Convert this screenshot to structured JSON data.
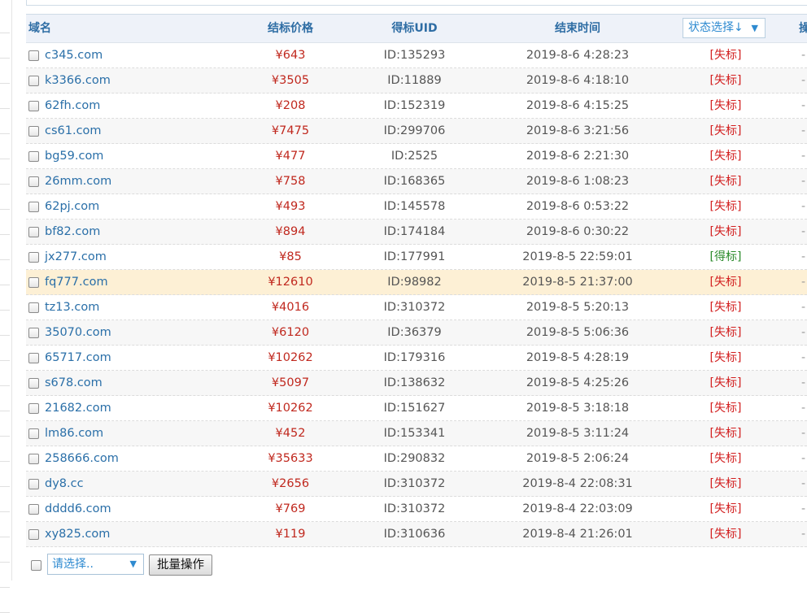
{
  "header": {
    "domain": "域名",
    "price": "结标价格",
    "uid": "得标UID",
    "end_time": "结束时间",
    "status_select": "状态选择↓",
    "status_arrow": "▼",
    "ops": "操"
  },
  "rows": [
    {
      "domain": "c345.com",
      "price": "¥643",
      "uid": "ID:135293",
      "time": "2019-8-6 4:28:23",
      "status": "[失标]",
      "ops": "-"
    },
    {
      "domain": "k3366.com",
      "price": "¥3505",
      "uid": "ID:11889",
      "time": "2019-8-6 4:18:10",
      "status": "[失标]",
      "ops": "-"
    },
    {
      "domain": "62fh.com",
      "price": "¥208",
      "uid": "ID:152319",
      "time": "2019-8-6 4:15:25",
      "status": "[失标]",
      "ops": "-"
    },
    {
      "domain": "cs61.com",
      "price": "¥7475",
      "uid": "ID:299706",
      "time": "2019-8-6 3:21:56",
      "status": "[失标]",
      "ops": "-"
    },
    {
      "domain": "bg59.com",
      "price": "¥477",
      "uid": "ID:2525",
      "time": "2019-8-6 2:21:30",
      "status": "[失标]",
      "ops": "-"
    },
    {
      "domain": "26mm.com",
      "price": "¥758",
      "uid": "ID:168365",
      "time": "2019-8-6 1:08:23",
      "status": "[失标]",
      "ops": "-"
    },
    {
      "domain": "62pj.com",
      "price": "¥493",
      "uid": "ID:145578",
      "time": "2019-8-6 0:53:22",
      "status": "[失标]",
      "ops": "-"
    },
    {
      "domain": "bf82.com",
      "price": "¥894",
      "uid": "ID:174184",
      "time": "2019-8-6 0:30:22",
      "status": "[失标]",
      "ops": "-"
    },
    {
      "domain": "jx277.com",
      "price": "¥85",
      "uid": "ID:177991",
      "time": "2019-8-5 22:59:01",
      "status": "[得标]",
      "ops": "-"
    },
    {
      "domain": "fq777.com",
      "price": "¥12610",
      "uid": "ID:98982",
      "time": "2019-8-5 21:37:00",
      "status": "[失标]",
      "ops": "-"
    },
    {
      "domain": "tz13.com",
      "price": "¥4016",
      "uid": "ID:310372",
      "time": "2019-8-5 5:20:13",
      "status": "[失标]",
      "ops": "-"
    },
    {
      "domain": "35070.com",
      "price": "¥6120",
      "uid": "ID:36379",
      "time": "2019-8-5 5:06:36",
      "status": "[失标]",
      "ops": "-"
    },
    {
      "domain": "65717.com",
      "price": "¥10262",
      "uid": "ID:179316",
      "time": "2019-8-5 4:28:19",
      "status": "[失标]",
      "ops": "-"
    },
    {
      "domain": "s678.com",
      "price": "¥5097",
      "uid": "ID:138632",
      "time": "2019-8-5 4:25:26",
      "status": "[失标]",
      "ops": "-"
    },
    {
      "domain": "21682.com",
      "price": "¥10262",
      "uid": "ID:151627",
      "time": "2019-8-5 3:18:18",
      "status": "[失标]",
      "ops": "-"
    },
    {
      "domain": "lm86.com",
      "price": "¥452",
      "uid": "ID:153341",
      "time": "2019-8-5 3:11:24",
      "status": "[失标]",
      "ops": "-"
    },
    {
      "domain": "258666.com",
      "price": "¥35633",
      "uid": "ID:290832",
      "time": "2019-8-5 2:06:24",
      "status": "[失标]",
      "ops": "-"
    },
    {
      "domain": "dy8.cc",
      "price": "¥2656",
      "uid": "ID:310372",
      "time": "2019-8-4 22:08:31",
      "status": "[失标]",
      "ops": "-"
    },
    {
      "domain": "dddd6.com",
      "price": "¥769",
      "uid": "ID:310372",
      "time": "2019-8-4 22:03:09",
      "status": "[失标]",
      "ops": "-"
    },
    {
      "domain": "xy825.com",
      "price": "¥119",
      "uid": "ID:310636",
      "time": "2019-8-4 21:26:01",
      "status": "[失标]",
      "ops": "-"
    }
  ],
  "highlighted_row": 9,
  "footer": {
    "bulk_select": "请选择..",
    "bulk_arrow": "▼",
    "bulk_button": "批量操作"
  },
  "colors": {
    "header_bg": "#eef2f9",
    "link": "#2a6fa8",
    "price": "#c0281e",
    "lose": "#d21e1e",
    "win": "#2a8a2a",
    "highlight": "#fdf0d5"
  }
}
